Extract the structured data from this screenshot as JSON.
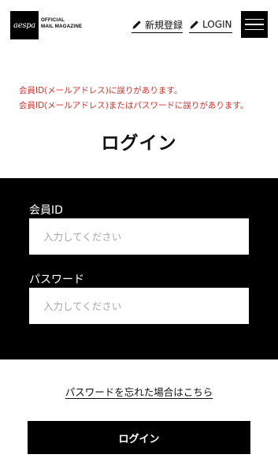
{
  "header": {
    "logo_text": "aespa",
    "logo_sub_line1": "OFFICIAL",
    "logo_sub_line2": "MAIL MAGAZINE",
    "register_label": "新規登録",
    "login_label": "LOGIN",
    "icons": {
      "link": "pencil-icon",
      "menu": "hamburger-menu-icon"
    }
  },
  "errors": [
    "会員ID(メールアドレス)に誤りがあります。",
    "会員ID(メールアドレス)またはパスワードに誤りがあります。"
  ],
  "page_title": "ログイン",
  "form": {
    "id_label": "会員ID",
    "id_value": "",
    "id_placeholder": "入力してください",
    "password_label": "パスワード",
    "password_value": "",
    "password_placeholder": "入力してください"
  },
  "forgot_link": "パスワードを忘れた場合はこちら",
  "submit_label": "ログイン",
  "colors": {
    "error": "#d0342c",
    "panel": "#000000",
    "background": "#ffffff",
    "placeholder": "#a8a8a8"
  }
}
